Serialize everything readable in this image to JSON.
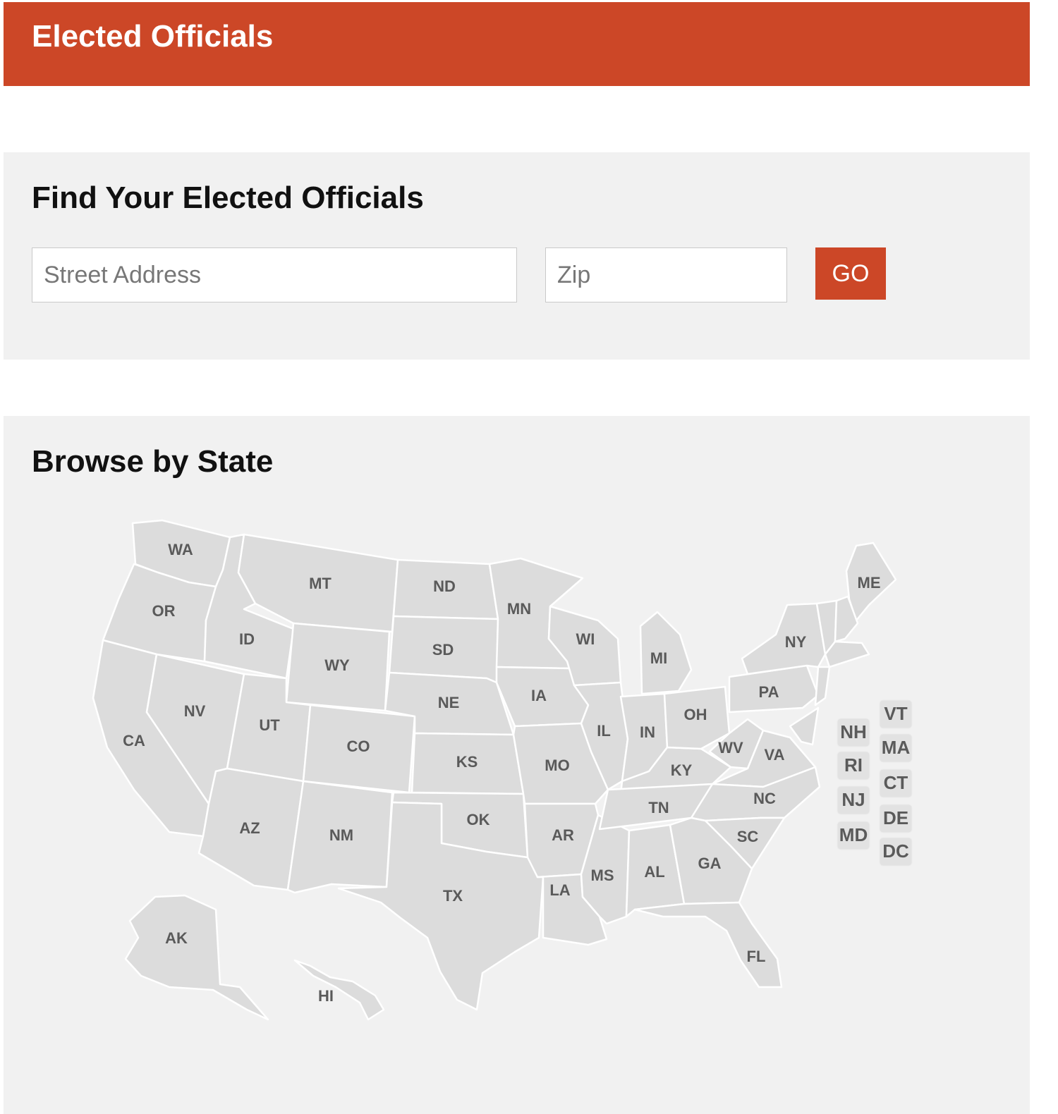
{
  "header": {
    "title": "Elected Officials"
  },
  "find": {
    "title": "Find Your Elected Officials",
    "street_placeholder": "Street Address",
    "zip_placeholder": "Zip",
    "go_label": "GO"
  },
  "browse": {
    "title": "Browse by State",
    "states": [
      "WA",
      "OR",
      "CA",
      "ID",
      "NV",
      "MT",
      "WY",
      "UT",
      "AZ",
      "CO",
      "NM",
      "ND",
      "SD",
      "NE",
      "KS",
      "OK",
      "TX",
      "MN",
      "IA",
      "MO",
      "AR",
      "LA",
      "WI",
      "IL",
      "MS",
      "MI",
      "IN",
      "KY",
      "TN",
      "AL",
      "OH",
      "WV",
      "VA",
      "NC",
      "SC",
      "GA",
      "FL",
      "PA",
      "NY",
      "ME",
      "AK",
      "HI"
    ],
    "small_states": [
      "NH",
      "RI",
      "NJ",
      "MD",
      "VT",
      "MA",
      "CT",
      "DE",
      "DC"
    ]
  },
  "colors": {
    "accent": "#cc4727",
    "panel": "#f1f1f1",
    "state_fill": "#dcdcdc",
    "label": "#5a5a5a"
  }
}
